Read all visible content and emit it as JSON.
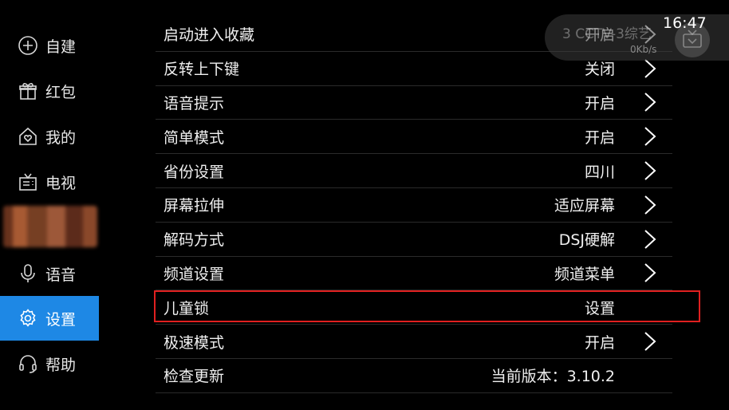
{
  "sidebar": {
    "items": [
      {
        "label": "自建",
        "icon": "plus-circle-icon"
      },
      {
        "label": "红包",
        "icon": "gift-icon"
      },
      {
        "label": "我的",
        "icon": "home-heart-icon"
      },
      {
        "label": "电视",
        "icon": "tv-icon"
      },
      {
        "label": "语音",
        "icon": "microphone-icon"
      },
      {
        "label": "设置",
        "icon": "gear-icon"
      },
      {
        "label": "帮助",
        "icon": "headset-icon"
      }
    ],
    "active": "设置"
  },
  "settings": {
    "rows": [
      {
        "label": "启动进入收藏",
        "value": "开启",
        "has_arrow": true
      },
      {
        "label": "反转上下键",
        "value": "关闭",
        "has_arrow": true
      },
      {
        "label": "语音提示",
        "value": "开启",
        "has_arrow": true
      },
      {
        "label": "简单模式",
        "value": "开启",
        "has_arrow": true
      },
      {
        "label": "省份设置",
        "value": "四川",
        "has_arrow": true
      },
      {
        "label": "屏幕拉伸",
        "value": "适应屏幕",
        "has_arrow": true
      },
      {
        "label": "解码方式",
        "value": "DSJ硬解",
        "has_arrow": true
      },
      {
        "label": "频道设置",
        "value": "频道菜单",
        "has_arrow": true
      },
      {
        "label": "儿童锁",
        "value": "设置",
        "has_arrow": false
      },
      {
        "label": "极速模式",
        "value": "开启",
        "has_arrow": true
      },
      {
        "label": "检查更新",
        "value": "当前版本：3.10.2",
        "has_arrow": false
      }
    ],
    "highlighted_row": "儿童锁"
  },
  "overlay": {
    "channel": "3  CCTV-3综艺",
    "speed": "0Kb/s",
    "logo_icon": "tv-logo-icon"
  },
  "clock": "16:47",
  "colors": {
    "accent": "#1e88e5",
    "highlight": "#e02020"
  }
}
